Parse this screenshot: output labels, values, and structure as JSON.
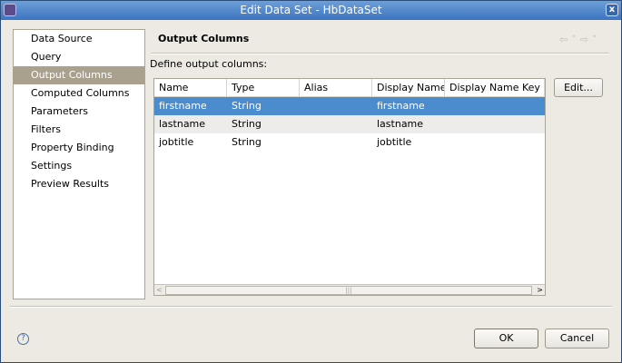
{
  "window": {
    "title": "Edit Data Set - HbDataSet"
  },
  "nav": {
    "items": [
      "Data Source",
      "Query",
      "Output Columns",
      "Computed Columns",
      "Parameters",
      "Filters",
      "Property Binding",
      "Settings",
      "Preview Results"
    ],
    "selected": "Output Columns"
  },
  "page": {
    "title": "Output Columns",
    "instruction": "Define output columns:",
    "back_icon": "⇦˅",
    "forward_icon": "⇨˅"
  },
  "table": {
    "columns": [
      "Name",
      "Type",
      "Alias",
      "Display Name",
      "Display Name Key"
    ],
    "rows": [
      [
        "firstname",
        "String",
        "",
        "firstname",
        ""
      ],
      [
        "lastname",
        "String",
        "",
        "lastname",
        ""
      ],
      [
        "jobtitle",
        "String",
        "",
        "jobtitle",
        ""
      ]
    ],
    "selected_row": 0
  },
  "buttons": {
    "edit": "Edit...",
    "ok": "OK",
    "cancel": "Cancel",
    "help": "?"
  },
  "colors": {
    "selection": "#4b8ccf",
    "nav_selection": "#a9a18e",
    "titlebar": "#3c74c0"
  }
}
